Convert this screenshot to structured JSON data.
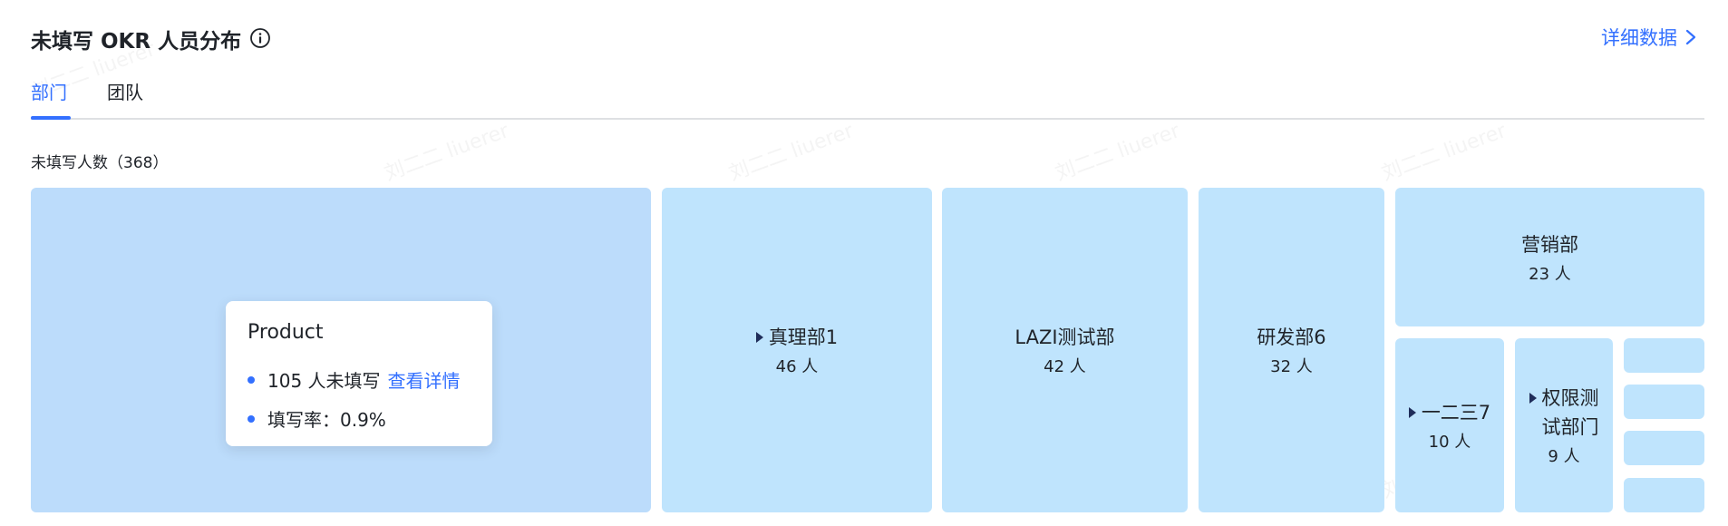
{
  "header": {
    "title": "未填写 OKR 人员分布",
    "detail_link": "详细数据"
  },
  "tabs": [
    {
      "label": "部门",
      "active": true
    },
    {
      "label": "团队",
      "active": false
    }
  ],
  "subtitle": "未填写人数（368）",
  "treemap": {
    "cells": [
      {
        "name": "Product",
        "count": "105 人",
        "expandable": false
      },
      {
        "name": "真理部1",
        "count": "46 人",
        "expandable": true
      },
      {
        "name": "LAZI测试部",
        "count": "42 人",
        "expandable": false
      },
      {
        "name": "研发部6",
        "count": "32 人",
        "expandable": false
      },
      {
        "name": "营销部",
        "count": "23 人",
        "expandable": false
      },
      {
        "name": "一二三7",
        "count": "10 人",
        "expandable": true
      },
      {
        "name_line1": "权限测",
        "name_line2": "试部门",
        "count": "9 人",
        "expandable": true
      }
    ]
  },
  "tooltip": {
    "title": "Product",
    "unfilled_text": "105 人未填写",
    "detail_link": "查看详情",
    "rate_text": "填写率：0.9%"
  },
  "watermark": {
    "name": "刘二二",
    "id": "liuerer"
  },
  "colors": {
    "accent": "#3370ff",
    "cell": "#bfe4fd",
    "cell_highlight": "#bcdcfb"
  }
}
